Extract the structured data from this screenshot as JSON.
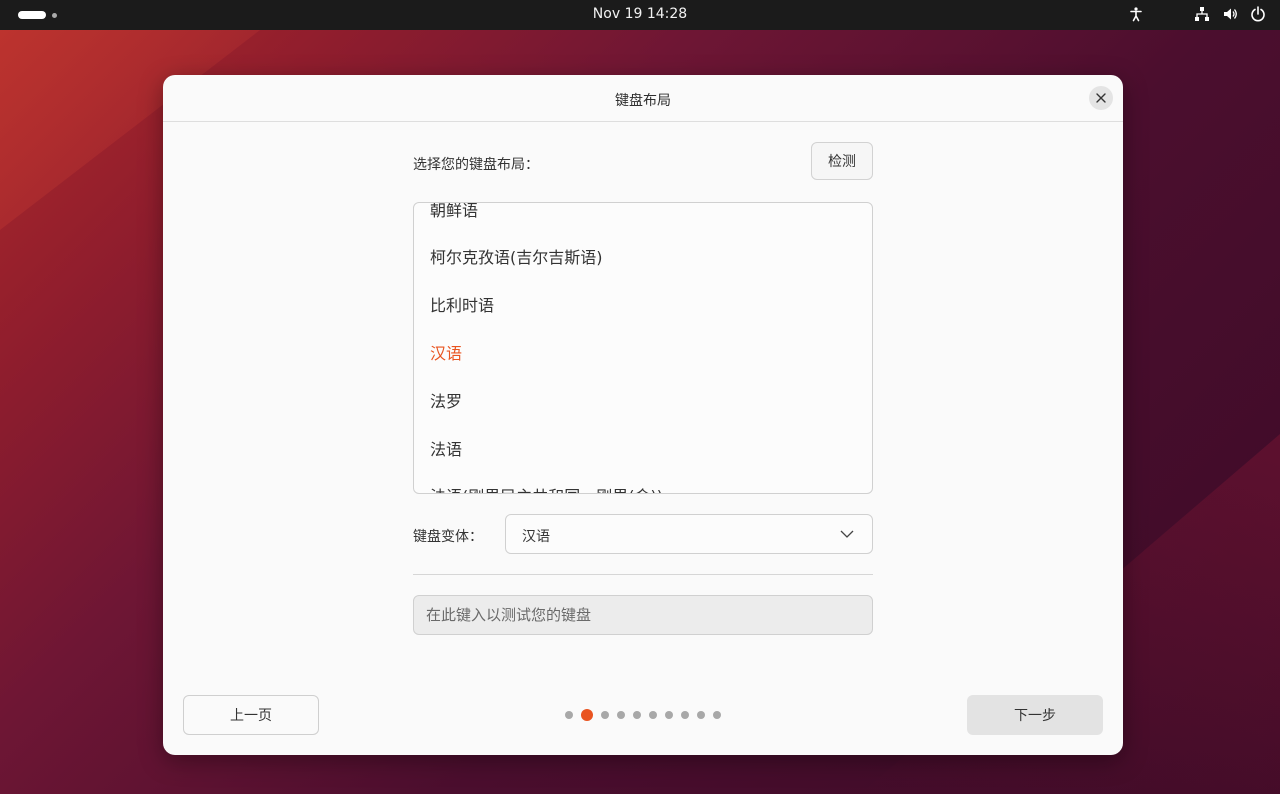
{
  "topbar": {
    "clock": "Nov 19  14:28",
    "tray_icons": [
      "accessibility-icon",
      "network-icon",
      "volume-icon",
      "power-icon"
    ]
  },
  "dialog": {
    "title": "键盘布局",
    "prompt": "选择您的键盘布局：",
    "detect_label": "检测",
    "layouts": [
      {
        "label": "朝鲜语"
      },
      {
        "label": "柯尔克孜语(吉尔吉斯语)"
      },
      {
        "label": "比利时语"
      },
      {
        "label": "汉语",
        "selected": true
      },
      {
        "label": "法罗"
      },
      {
        "label": "法语"
      },
      {
        "label": "法语(刚果民主共和国，刚果(金))"
      }
    ],
    "variant_label": "键盘变体：",
    "variant_value": "汉语",
    "test_placeholder": "在此键入以测试您的键盘",
    "back_label": "上一页",
    "next_label": "下一步",
    "pager": {
      "total": 10,
      "current": 2
    }
  },
  "colors": {
    "accent": "#e95420",
    "topbar": "#1b1b1b",
    "dialog_bg": "#fafafa"
  }
}
